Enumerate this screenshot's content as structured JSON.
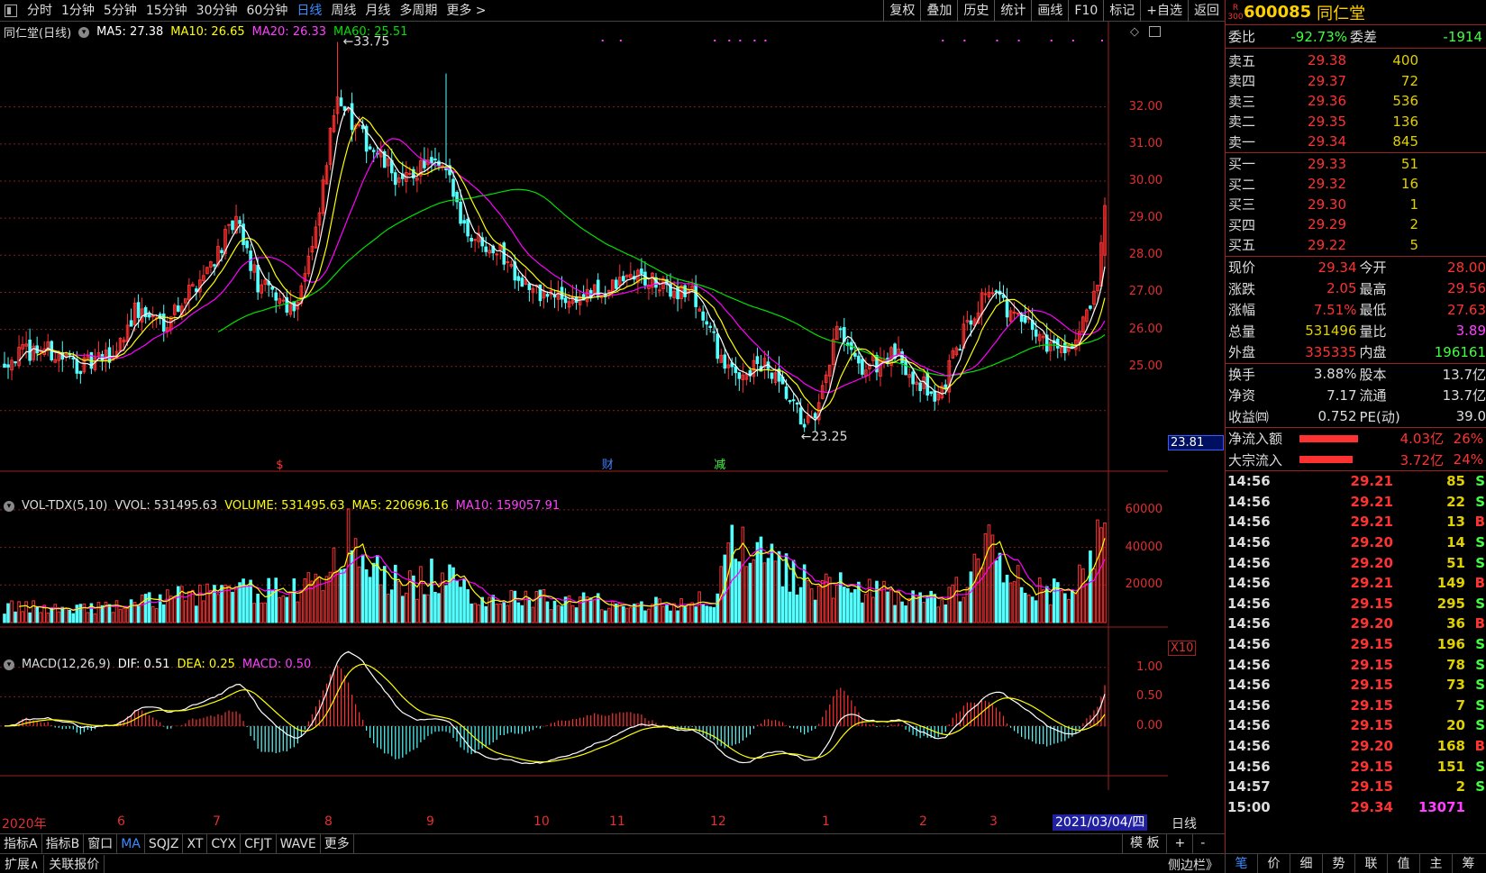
{
  "toolbar": {
    "left": [
      "分时",
      "1分钟",
      "5分钟",
      "15分钟",
      "30分钟",
      "60分钟",
      "日线",
      "周线",
      "月线",
      "多周期",
      "更多 >"
    ],
    "active_index": 6,
    "right": [
      "复权",
      "叠加",
      "历史",
      "统计",
      "画线",
      "F10",
      "标记",
      "+自选",
      "返回"
    ]
  },
  "kline": {
    "legend_name": "同仁堂(日线)",
    "ma5": "MA5: 27.38",
    "ma10": "MA10: 26.65",
    "ma20": "MA20: 26.33",
    "ma60": "MA60: 25.51",
    "high_label": "33.75",
    "low_label": "23.25",
    "current_box": "23.81",
    "ticks": [
      "32.00",
      "31.00",
      "30.00",
      "29.00",
      "28.00",
      "27.00",
      "26.00",
      "25.00"
    ],
    "tick_values": [
      32,
      31,
      30,
      29,
      28,
      27,
      26,
      25
    ],
    "ymin": 22.2,
    "ymax": 34.3,
    "markers": [
      "$",
      "财",
      "减"
    ],
    "colors": {
      "up": "#ff3232",
      "down": "#54ffff",
      "ma5": "#ffffff",
      "ma10": "#ffff00",
      "ma20": "#ff00ff",
      "ma60": "#00e000"
    }
  },
  "volume": {
    "legend_name": "VOL-TDX(5,10)",
    "vvol": "VVOL: 531495.63",
    "volume": "VOLUME: 531495.63",
    "ma5": "MA5: 220696.16",
    "ma10": "MA10: 159057.91",
    "ticks": [
      "60000",
      "40000",
      "20000"
    ],
    "tick_values": [
      60000,
      40000,
      20000
    ],
    "ymax": 70000,
    "unit": "X10"
  },
  "macd": {
    "legend_name": "MACD(12,26,9)",
    "dif": "DIF: 0.51",
    "dea": "DEA: 0.25",
    "macd": "MACD: 0.50",
    "ticks": [
      "1.00",
      "0.50",
      "0.00"
    ],
    "tick_values": [
      1.0,
      0.5,
      0.0
    ],
    "ymin": -0.8,
    "ymax": 1.35
  },
  "xaxis": {
    "labels": [
      "2020年",
      "6",
      "7",
      "8",
      "9",
      "10",
      "11",
      "12",
      "1",
      "2",
      "3"
    ],
    "date_box": "2021/03/04/四",
    "period": "日线"
  },
  "bottom_tabs": [
    "指标A",
    "指标B",
    "窗口",
    "MA",
    "SQJZ",
    "XT",
    "CYX",
    "CFJT",
    "WAVE",
    "更多"
  ],
  "bottom_active": 3,
  "bottom_right": [
    "模 板",
    "+",
    "-"
  ],
  "status_left": [
    "扩展∧",
    "关联报价"
  ],
  "status_mid": "侧边栏》",
  "right_tabs": [
    "笔",
    "价",
    "细",
    "势",
    "联",
    "值",
    "主",
    "筹"
  ],
  "right_tab_active": 0,
  "stock": {
    "badge_top": "R",
    "badge_bottom": "300",
    "code": "600085",
    "name": "同仁堂"
  },
  "weibi": {
    "label1": "委比",
    "value1": "-92.73%",
    "label2": "委差",
    "value2": "-1914"
  },
  "asks": [
    {
      "label": "卖五",
      "price": "29.38",
      "vol": "400"
    },
    {
      "label": "卖四",
      "price": "29.37",
      "vol": "72"
    },
    {
      "label": "卖三",
      "price": "29.36",
      "vol": "536"
    },
    {
      "label": "卖二",
      "price": "29.35",
      "vol": "136"
    },
    {
      "label": "卖一",
      "price": "29.34",
      "vol": "845"
    }
  ],
  "bids": [
    {
      "label": "买一",
      "price": "29.33",
      "vol": "51"
    },
    {
      "label": "买二",
      "price": "29.32",
      "vol": "16"
    },
    {
      "label": "买三",
      "price": "29.30",
      "vol": "1"
    },
    {
      "label": "买四",
      "price": "29.29",
      "vol": "2"
    },
    {
      "label": "买五",
      "price": "29.22",
      "vol": "5"
    }
  ],
  "quote": [
    {
      "l1": "现价",
      "v1": "29.34",
      "c1": "#ff3232",
      "l2": "今开",
      "v2": "28.00",
      "c2": "#ff3232"
    },
    {
      "l1": "涨跌",
      "v1": "2.05",
      "c1": "#ff3232",
      "l2": "最高",
      "v2": "29.56",
      "c2": "#ff3232"
    },
    {
      "l1": "涨幅",
      "v1": "7.51%",
      "c1": "#ff3232",
      "l2": "最低",
      "v2": "27.63",
      "c2": "#ff3232"
    },
    {
      "l1": "总量",
      "v1": "531496",
      "c1": "#e0d000",
      "l2": "量比",
      "v2": "3.89",
      "c2": "#ff40ff"
    },
    {
      "l1": "外盘",
      "v1": "335335",
      "c1": "#ff3232",
      "l2": "内盘",
      "v2": "196161",
      "c2": "#40ff40"
    }
  ],
  "quote2": [
    {
      "l1": "换手",
      "v1": "3.88%",
      "c1": "#dddddd",
      "l2": "股本",
      "v2": "13.7亿",
      "c2": "#dddddd"
    },
    {
      "l1": "净资",
      "v1": "7.17",
      "c1": "#dddddd",
      "l2": "流通",
      "v2": "13.7亿",
      "c2": "#dddddd"
    },
    {
      "l1": "收益㈣",
      "v1": "0.752",
      "c1": "#dddddd",
      "l2": "PE(动)",
      "v2": "39.0",
      "c2": "#dddddd"
    }
  ],
  "flow": [
    {
      "label": "净流入额",
      "value": "4.03亿",
      "pct": "26%",
      "bar": 0.85
    },
    {
      "label": "大宗流入",
      "value": "3.72亿",
      "pct": "24%",
      "bar": 0.78
    }
  ],
  "trades": [
    {
      "t": "14:56",
      "p": "29.21",
      "v": "85",
      "s": "S"
    },
    {
      "t": "14:56",
      "p": "29.21",
      "v": "22",
      "s": "S"
    },
    {
      "t": "14:56",
      "p": "29.21",
      "v": "13",
      "s": "B"
    },
    {
      "t": "14:56",
      "p": "29.20",
      "v": "14",
      "s": "S"
    },
    {
      "t": "14:56",
      "p": "29.20",
      "v": "51",
      "s": "S"
    },
    {
      "t": "14:56",
      "p": "29.21",
      "v": "149",
      "s": "B"
    },
    {
      "t": "14:56",
      "p": "29.15",
      "v": "295",
      "s": "S"
    },
    {
      "t": "14:56",
      "p": "29.20",
      "v": "36",
      "s": "B"
    },
    {
      "t": "14:56",
      "p": "29.15",
      "v": "196",
      "s": "S"
    },
    {
      "t": "14:56",
      "p": "29.15",
      "v": "78",
      "s": "S"
    },
    {
      "t": "14:56",
      "p": "29.15",
      "v": "73",
      "s": "S"
    },
    {
      "t": "14:56",
      "p": "29.15",
      "v": "7",
      "s": "S"
    },
    {
      "t": "14:56",
      "p": "29.15",
      "v": "20",
      "s": "S"
    },
    {
      "t": "14:56",
      "p": "29.20",
      "v": "168",
      "s": "B"
    },
    {
      "t": "14:56",
      "p": "29.15",
      "v": "151",
      "s": "S"
    },
    {
      "t": "14:57",
      "p": "29.15",
      "v": "2",
      "s": "S"
    },
    {
      "t": "15:00",
      "p": "29.34",
      "v": "13071",
      "s": ""
    }
  ],
  "chart_data": {
    "type": "candlestick",
    "title": "同仁堂(日线)",
    "anchors_close": [
      [
        0,
        25.2
      ],
      [
        10,
        25.5
      ],
      [
        22,
        25.0
      ],
      [
        30,
        25.3
      ],
      [
        36,
        26.5
      ],
      [
        44,
        26.2
      ],
      [
        55,
        27.5
      ],
      [
        64,
        28.9
      ],
      [
        70,
        27.2
      ],
      [
        80,
        26.6
      ],
      [
        86,
        28.5
      ],
      [
        92,
        32.5
      ],
      [
        96,
        31.5
      ],
      [
        104,
        30.6
      ],
      [
        110,
        29.9
      ],
      [
        116,
        30.5
      ],
      [
        122,
        30.2
      ],
      [
        128,
        28.6
      ],
      [
        136,
        28.2
      ],
      [
        146,
        27.0
      ],
      [
        156,
        26.8
      ],
      [
        166,
        27.0
      ],
      [
        174,
        27.5
      ],
      [
        182,
        27.1
      ],
      [
        190,
        27.0
      ],
      [
        200,
        24.8
      ],
      [
        210,
        25.0
      ],
      [
        220,
        23.6
      ],
      [
        224,
        23.4
      ],
      [
        230,
        26.0
      ],
      [
        236,
        24.9
      ],
      [
        246,
        25.3
      ],
      [
        252,
        24.7
      ],
      [
        258,
        24.1
      ],
      [
        266,
        26.2
      ],
      [
        272,
        27.2
      ],
      [
        278,
        26.4
      ],
      [
        284,
        26.0
      ],
      [
        290,
        25.5
      ],
      [
        296,
        25.7
      ],
      [
        302,
        27.0
      ],
      [
        304,
        29.34
      ]
    ],
    "n_bars": 305,
    "vol_anchors": [
      [
        0,
        8000
      ],
      [
        30,
        8000
      ],
      [
        50,
        15000
      ],
      [
        70,
        17000
      ],
      [
        88,
        20000
      ],
      [
        92,
        50000
      ],
      [
        100,
        30000
      ],
      [
        110,
        20000
      ],
      [
        120,
        25000
      ],
      [
        130,
        14000
      ],
      [
        180,
        10000
      ],
      [
        196,
        12000
      ],
      [
        200,
        38000
      ],
      [
        215,
        28000
      ],
      [
        225,
        20000
      ],
      [
        232,
        18000
      ],
      [
        260,
        12000
      ],
      [
        266,
        22000
      ],
      [
        272,
        38000
      ],
      [
        280,
        24000
      ],
      [
        295,
        12000
      ],
      [
        304,
        53000
      ]
    ]
  }
}
